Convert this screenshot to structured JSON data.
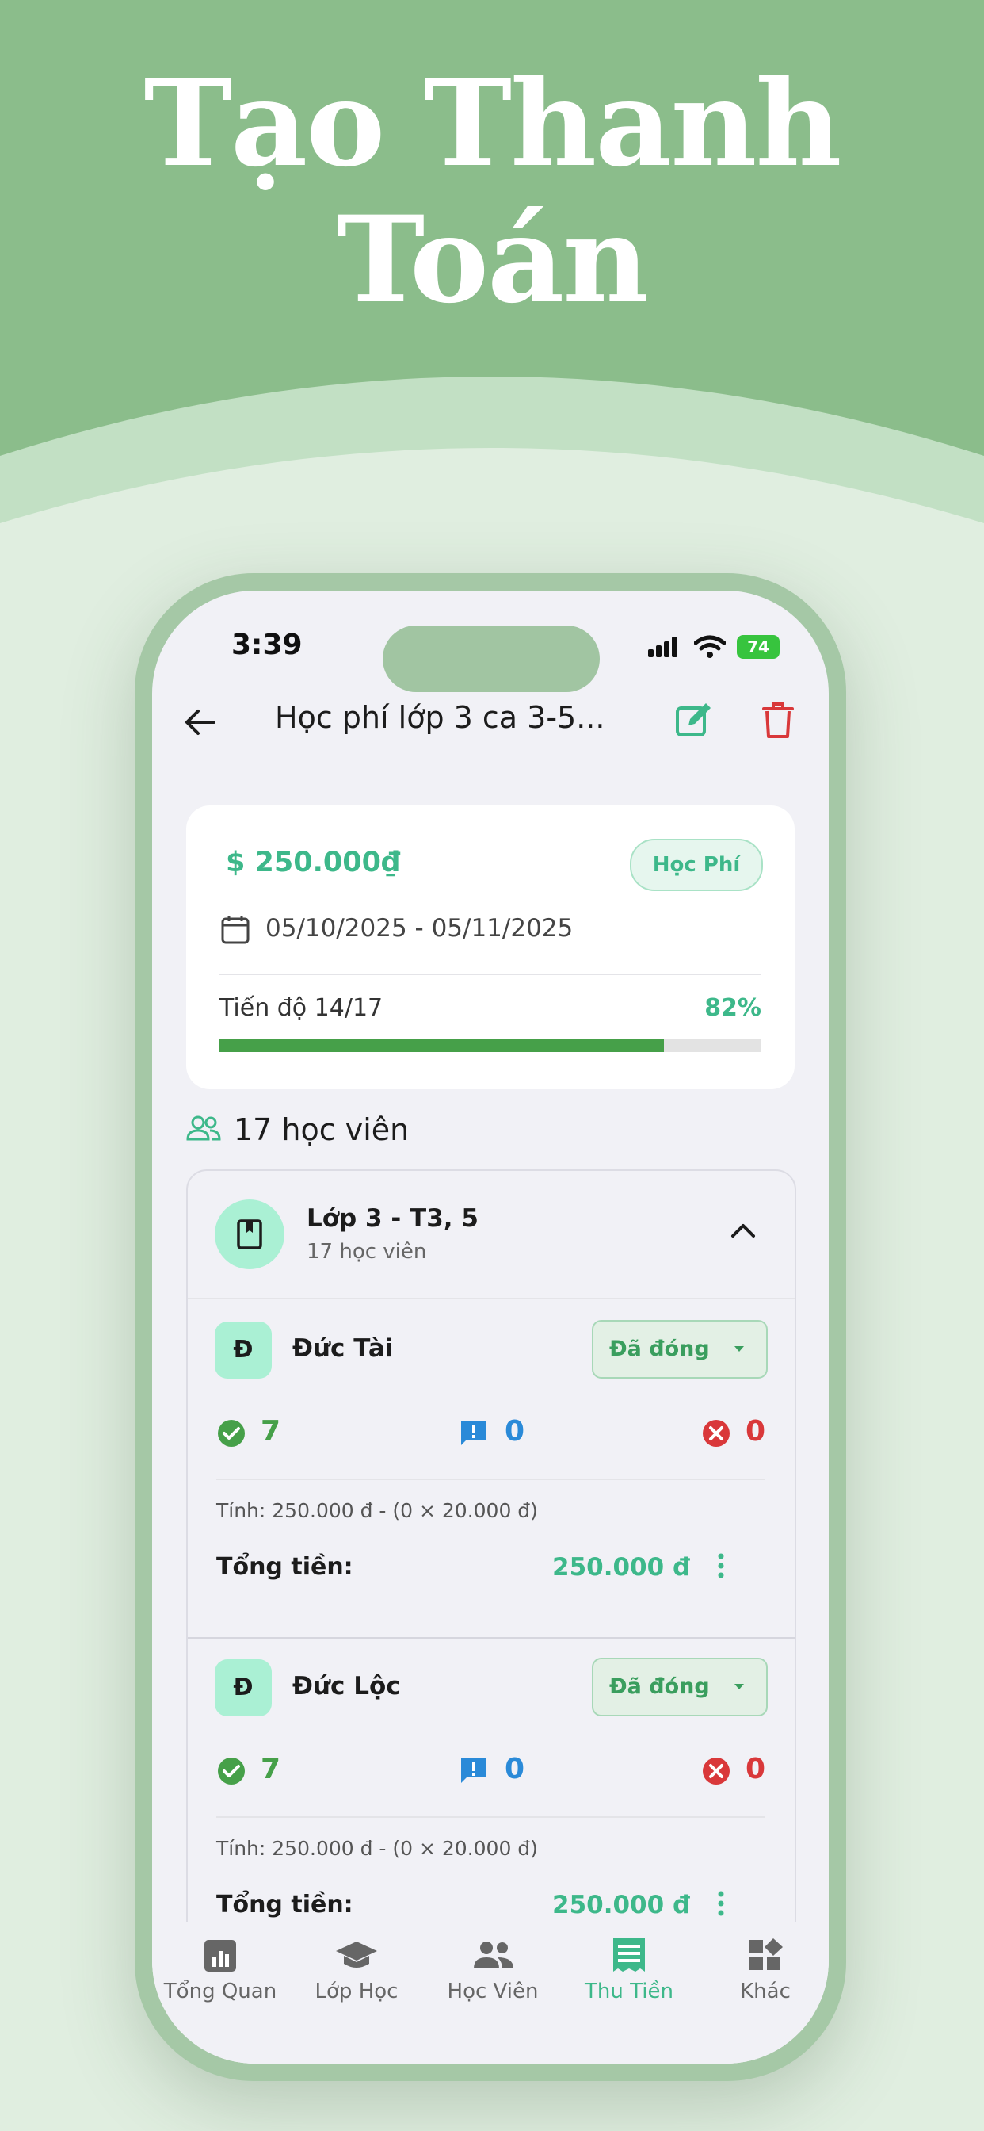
{
  "banner": {
    "title_line1": "Tạo Thanh",
    "title_line2": "Toán"
  },
  "status_bar": {
    "time": "3:39",
    "battery": "74"
  },
  "header": {
    "title": "Học phí lớp 3 ca 3-5..."
  },
  "summary": {
    "amount": "$ 250.000₫",
    "tag": "Học Phí",
    "date_range": "05/10/2025 - 05/11/2025",
    "progress_label": "Tiến độ  14/17",
    "progress_percent": "82%",
    "progress_value": 0.82
  },
  "students_count": "17 học viên",
  "group": {
    "title": "Lớp 3 - T3, 5",
    "subtitle": "17 học viên"
  },
  "students": [
    {
      "initial": "Đ",
      "name": "Đức Tài",
      "status": "Đã đóng",
      "present": "7",
      "excused": "0",
      "absent": "0",
      "calc": "Tính: 250.000 đ - (0 × 20.000 đ)",
      "total_label": "Tổng tiền:",
      "total": "250.000 đ"
    },
    {
      "initial": "Đ",
      "name": "Đức Lộc",
      "status": "Đã đóng",
      "present": "7",
      "excused": "0",
      "absent": "0",
      "calc": "Tính: 250.000 đ - (0 × 20.000 đ)",
      "total_label": "Tổng tiền:",
      "total": "250.000 đ"
    }
  ],
  "nav": [
    {
      "label": "Tổng Quan",
      "icon": "chart-icon",
      "active": false
    },
    {
      "label": "Lớp Học",
      "icon": "graduation-cap-icon",
      "active": false
    },
    {
      "label": "Học Viên",
      "icon": "people-icon",
      "active": false
    },
    {
      "label": "Thu Tiền",
      "icon": "receipt-icon",
      "active": true
    },
    {
      "label": "Khác",
      "icon": "widgets-icon",
      "active": false
    }
  ],
  "colors": {
    "accent": "#3db88a",
    "banner": "#8bbd8b",
    "progress": "#46a049",
    "danger": "#d9383a",
    "info": "#2a8ad8"
  }
}
